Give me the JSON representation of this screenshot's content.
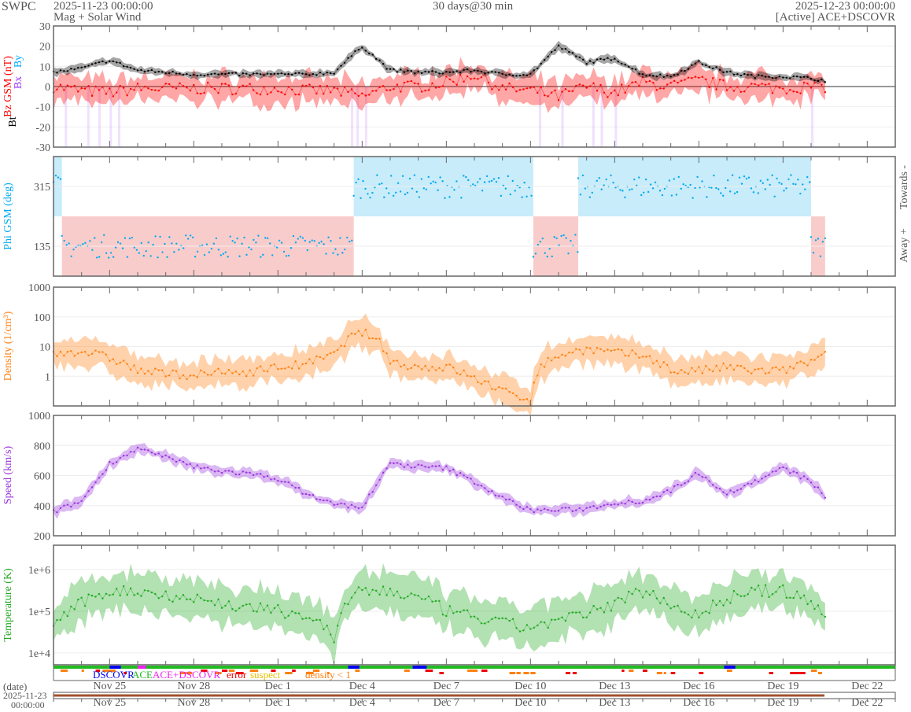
{
  "header": {
    "org": "SWPC",
    "start": "2025-11-23 00:00:00",
    "subtitle": "Mag + Solar Wind",
    "center": "30 days@30 min",
    "end": "2025-12-23 00:00:00",
    "source": "[Active] ACE+DSCOVR"
  },
  "colors": {
    "bt": "#000000",
    "bz": "#ff0000",
    "bx": "#9933ff",
    "by": "#00aaff",
    "phi": "#00aaee",
    "toward": "#c8ecfa",
    "away": "#f9cccc",
    "density": "#ff7f0e",
    "speed": "#9933dd",
    "temp": "#22aa22"
  },
  "chart_data": [
    {
      "type": "line",
      "name": "mag",
      "ylabel_parts": [
        "Bt",
        "Bz GSM (nT)",
        "Bx",
        "By"
      ],
      "ylim": [
        -30,
        30
      ],
      "yticks": [
        "30",
        "20",
        "10",
        "0",
        "-10",
        "-20",
        "-30"
      ],
      "days": [
        0,
        1,
        2,
        3,
        4,
        5,
        6,
        7,
        8,
        9,
        10,
        11,
        12,
        13,
        14,
        15,
        16,
        17,
        18,
        19,
        20,
        21,
        22,
        23,
        24,
        25,
        26,
        27,
        27.5
      ],
      "bt": [
        7,
        9,
        13,
        8,
        7,
        6,
        6,
        6,
        6,
        6,
        7,
        20,
        8,
        7,
        7,
        8,
        6,
        6,
        20,
        12,
        14,
        6,
        5,
        12,
        7,
        5,
        5,
        4,
        3
      ],
      "bz": [
        0,
        -2,
        -3,
        -1,
        -1,
        -1,
        -1,
        -1,
        -1,
        -2,
        -2,
        -5,
        0,
        0,
        2,
        6,
        -1,
        -2,
        -5,
        0,
        -3,
        2,
        0,
        3,
        0,
        0,
        -1,
        0,
        0
      ]
    },
    {
      "type": "scatter",
      "name": "phi",
      "ylabel": "Phi GSM (deg)",
      "ylim": [
        45,
        405
      ],
      "yticks": [
        "315",
        "135"
      ],
      "right_labels": [
        "Towards -",
        "Away +"
      ],
      "sectors": [
        {
          "start": 0,
          "end": 0.3,
          "sector": "toward"
        },
        {
          "start": 0.3,
          "end": 10.7,
          "sector": "away"
        },
        {
          "start": 10.7,
          "end": 17.1,
          "sector": "toward"
        },
        {
          "start": 17.1,
          "end": 18.7,
          "sector": "away"
        },
        {
          "start": 18.7,
          "end": 27,
          "sector": "toward"
        },
        {
          "start": 27,
          "end": 27.5,
          "sector": "away"
        }
      ]
    },
    {
      "type": "line",
      "name": "density",
      "ylabel": "Density (1/cm³)",
      "scale": "log",
      "ylim": [
        0.1,
        1000
      ],
      "yticks": [
        "1000",
        "100",
        "10",
        "1"
      ],
      "days": [
        0,
        1,
        2,
        3,
        4,
        5,
        6,
        7,
        8,
        9,
        10,
        11,
        12,
        13,
        14,
        15,
        16,
        17,
        18,
        19,
        20,
        21,
        22,
        23,
        24,
        25,
        26,
        27,
        27.5
      ],
      "values": [
        6,
        7,
        4,
        1.5,
        1.2,
        1.1,
        1.3,
        1.4,
        2,
        2.5,
        5,
        30,
        3,
        2,
        2,
        0.8,
        0.3,
        0.15,
        5,
        8,
        6,
        5,
        1.5,
        1.5,
        2,
        1.5,
        1.5,
        3,
        5
      ]
    },
    {
      "type": "line",
      "name": "speed",
      "ylabel": "Speed (km/s)",
      "ylim": [
        200,
        1000
      ],
      "yticks": [
        "1000",
        "800",
        "600",
        "400",
        "200"
      ],
      "days": [
        0,
        1,
        2,
        3,
        4,
        5,
        6,
        7,
        8,
        9,
        10,
        11,
        12,
        13,
        14,
        15,
        16,
        17,
        18,
        19,
        20,
        21,
        22,
        23,
        24,
        25,
        26,
        27,
        27.5
      ],
      "values": [
        360,
        430,
        680,
        780,
        720,
        660,
        630,
        610,
        580,
        480,
        410,
        390,
        680,
        660,
        650,
        560,
        450,
        370,
        370,
        380,
        420,
        430,
        500,
        620,
        480,
        560,
        650,
        560,
        460
      ]
    },
    {
      "type": "line",
      "name": "temperature",
      "ylabel": "Temperature (K)",
      "scale": "log",
      "ylim": [
        5200,
        3800000
      ],
      "yticks": [
        "1e+6",
        "1e+5",
        "1e+4"
      ],
      "days": [
        0,
        1,
        2,
        3,
        4,
        5,
        6,
        7,
        8,
        9,
        10,
        11,
        12,
        13,
        14,
        15,
        16,
        17,
        18,
        19,
        20,
        21,
        22,
        23,
        24,
        25,
        26,
        27,
        27.5
      ],
      "values": [
        40000,
        150000,
        300000,
        300000,
        250000,
        200000,
        150000,
        120000,
        100000,
        80000,
        20000,
        300000,
        300000,
        200000,
        100000,
        70000,
        50000,
        40000,
        60000,
        80000,
        150000,
        300000,
        150000,
        70000,
        200000,
        300000,
        300000,
        150000,
        80000
      ]
    }
  ],
  "legend": {
    "label_date": "(date)",
    "date": "2025-11-23",
    "time": "00:00:00",
    "dscovr": "DSCOVR",
    "ace": "ACE",
    "both": "ACE+DSCOVR",
    "error": "error",
    "suspect": "suspect",
    "density": "density < 1"
  },
  "xticks": [
    {
      "day": 2,
      "label": "Nov 25"
    },
    {
      "day": 5,
      "label": "Nov 28"
    },
    {
      "day": 8,
      "label": "Dec 1"
    },
    {
      "day": 11,
      "label": "Dec 4"
    },
    {
      "day": 14,
      "label": "Dec 7"
    },
    {
      "day": 17,
      "label": "Dec 10"
    },
    {
      "day": 20,
      "label": "Dec 13"
    },
    {
      "day": 23,
      "label": "Dec 16"
    },
    {
      "day": 26,
      "label": "Dec 19"
    },
    {
      "day": 29,
      "label": "Dec 22"
    }
  ]
}
